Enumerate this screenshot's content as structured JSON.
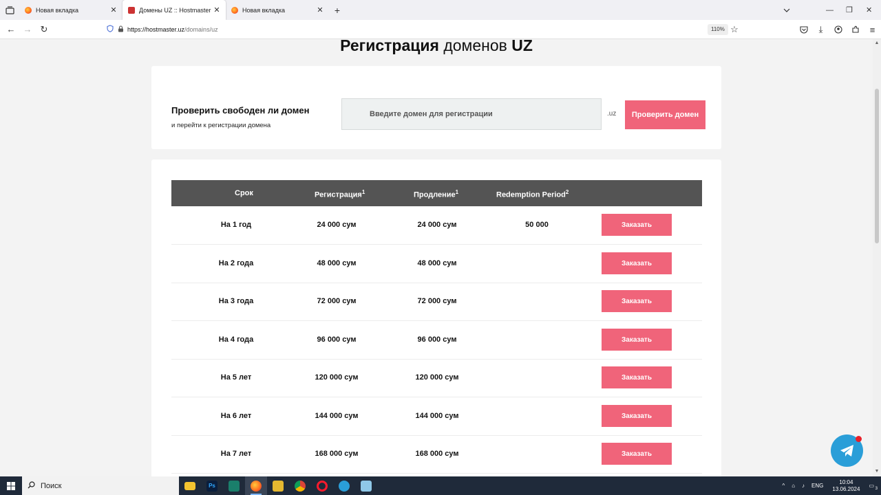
{
  "browser": {
    "tabs": [
      {
        "label": "Новая вкладка",
        "active": false
      },
      {
        "label": "Домены UZ :: Hostmaster",
        "active": true
      },
      {
        "label": "Новая вкладка",
        "active": false
      }
    ],
    "url_host": "https://hostmaster.uz",
    "url_path": "/domains/uz",
    "zoom": "110%"
  },
  "page": {
    "title_bold_1": "Регистрация",
    "title_normal": " доменов ",
    "title_bold_2": "UZ",
    "check": {
      "title": "Проверить свободен ли домен",
      "subtitle": "и перейти к регистрации домена",
      "input_placeholder": "Введите домен для регистрации",
      "tld": ".uz",
      "button": "Проверить домен"
    },
    "table": {
      "headers": {
        "term": "Срок",
        "registration": "Регистрация",
        "registration_sup": "1",
        "renewal": "Продление",
        "renewal_sup": "1",
        "redemption": "Redemption Period",
        "redemption_sup": "2"
      },
      "order_label": "Заказать",
      "rows": [
        {
          "term": "На 1 год",
          "registration": "24 000 сум",
          "renewal": "24 000 сум",
          "redemption": "50 000"
        },
        {
          "term": "На 2 года",
          "registration": "48 000 сум",
          "renewal": "48 000 сум",
          "redemption": ""
        },
        {
          "term": "На 3 года",
          "registration": "72 000 сум",
          "renewal": "72 000 сум",
          "redemption": ""
        },
        {
          "term": "На 4 года",
          "registration": "96 000 сум",
          "renewal": "96 000 сум",
          "redemption": ""
        },
        {
          "term": "На 5 лет",
          "registration": "120 000 сум",
          "renewal": "120 000 сум",
          "redemption": ""
        },
        {
          "term": "На 6 лет",
          "registration": "144 000 сум",
          "renewal": "144 000 сум",
          "redemption": ""
        },
        {
          "term": "На 7 лет",
          "registration": "168 000 сум",
          "renewal": "168 000 сум",
          "redemption": ""
        }
      ]
    }
  },
  "taskbar": {
    "search_label": "Поиск",
    "lang": "ENG",
    "time": "10:04",
    "date": "13.06.2024",
    "notifications": "3"
  },
  "colors": {
    "accent_pink": "#f0647a",
    "table_header": "#545454",
    "telegram_blue": "#2a9ed8"
  }
}
